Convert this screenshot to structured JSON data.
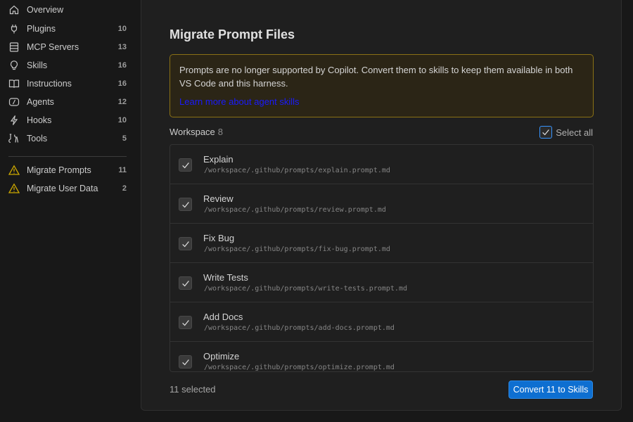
{
  "sidebar": {
    "items": [
      {
        "label": "Overview",
        "count": "",
        "icon": "home-icon"
      },
      {
        "label": "Plugins",
        "count": "10",
        "icon": "plug-icon"
      },
      {
        "label": "MCP Servers",
        "count": "13",
        "icon": "server-icon"
      },
      {
        "label": "Skills",
        "count": "16",
        "icon": "lightbulb-icon"
      },
      {
        "label": "Instructions",
        "count": "16",
        "icon": "book-icon"
      },
      {
        "label": "Agents",
        "count": "12",
        "icon": "agent-icon"
      },
      {
        "label": "Hooks",
        "count": "10",
        "icon": "lightning-icon"
      },
      {
        "label": "Tools",
        "count": "5",
        "icon": "tools-icon"
      }
    ],
    "migrate_items": [
      {
        "label": "Migrate Prompts",
        "count": "11",
        "icon": "warning-icon"
      },
      {
        "label": "Migrate User Data",
        "count": "2",
        "icon": "warning-icon"
      }
    ]
  },
  "main": {
    "title": "Migrate Prompt Files",
    "warning": {
      "text": "Prompts are no longer supported by Copilot. Convert them to skills to keep them available in both VS Code and this harness.",
      "link": "Learn more about agent skills"
    },
    "workspace": {
      "label": "Workspace",
      "count": "8"
    },
    "select_all_label": "Select all",
    "files": [
      {
        "name": "Explain",
        "path": "/workspace/.github/prompts/explain.prompt.md",
        "checked": true
      },
      {
        "name": "Review",
        "path": "/workspace/.github/prompts/review.prompt.md",
        "checked": true
      },
      {
        "name": "Fix Bug",
        "path": "/workspace/.github/prompts/fix-bug.prompt.md",
        "checked": true
      },
      {
        "name": "Write Tests",
        "path": "/workspace/.github/prompts/write-tests.prompt.md",
        "checked": true
      },
      {
        "name": "Add Docs",
        "path": "/workspace/.github/prompts/add-docs.prompt.md",
        "checked": true
      },
      {
        "name": "Optimize",
        "path": "/workspace/.github/prompts/optimize.prompt.md",
        "checked": true
      }
    ],
    "footer": {
      "selected_text": "11 selected",
      "convert_label": "Convert 11 to Skills"
    }
  },
  "colors": {
    "accent": "#0e6fd1",
    "warning": "#cca700",
    "warning_border": "#8a7115"
  }
}
